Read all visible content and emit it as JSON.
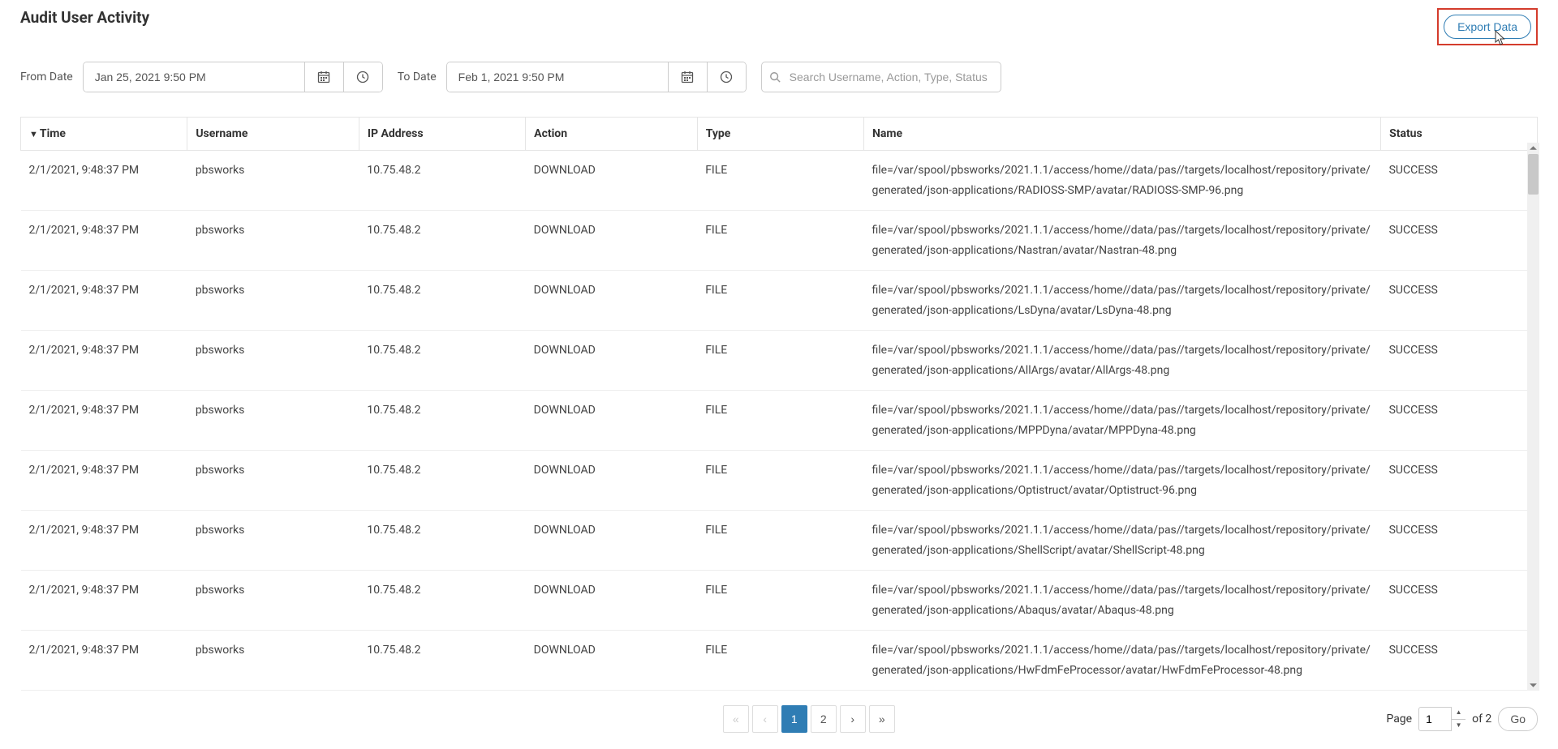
{
  "page_title": "Audit User Activity",
  "export_label": "Export Data",
  "filters": {
    "from_label": "From Date",
    "to_label": "To Date",
    "from_value": "Jan 25, 2021 9:50 PM",
    "to_value": "Feb 1, 2021 9:50 PM",
    "search_placeholder": "Search Username, Action, Type, Status"
  },
  "columns": {
    "time": "Time",
    "username": "Username",
    "ip": "IP Address",
    "action": "Action",
    "type": "Type",
    "name": "Name",
    "status": "Status"
  },
  "sort_indicator": "▼",
  "rows": [
    {
      "time": "2/1/2021, 9:48:37 PM",
      "user": "pbsworks",
      "ip": "10.75.48.2",
      "action": "DOWNLOAD",
      "type": "FILE",
      "name": "file=/var/spool/pbsworks/2021.1.1/access/home//data/pas//targets/localhost/repository/private/generated/json-applications/RADIOSS-SMP/avatar/RADIOSS-SMP-96.png",
      "status": "SUCCESS"
    },
    {
      "time": "2/1/2021, 9:48:37 PM",
      "user": "pbsworks",
      "ip": "10.75.48.2",
      "action": "DOWNLOAD",
      "type": "FILE",
      "name": "file=/var/spool/pbsworks/2021.1.1/access/home//data/pas//targets/localhost/repository/private/generated/json-applications/Nastran/avatar/Nastran-48.png",
      "status": "SUCCESS"
    },
    {
      "time": "2/1/2021, 9:48:37 PM",
      "user": "pbsworks",
      "ip": "10.75.48.2",
      "action": "DOWNLOAD",
      "type": "FILE",
      "name": "file=/var/spool/pbsworks/2021.1.1/access/home//data/pas//targets/localhost/repository/private/generated/json-applications/LsDyna/avatar/LsDyna-48.png",
      "status": "SUCCESS"
    },
    {
      "time": "2/1/2021, 9:48:37 PM",
      "user": "pbsworks",
      "ip": "10.75.48.2",
      "action": "DOWNLOAD",
      "type": "FILE",
      "name": "file=/var/spool/pbsworks/2021.1.1/access/home//data/pas//targets/localhost/repository/private/generated/json-applications/AllArgs/avatar/AllArgs-48.png",
      "status": "SUCCESS"
    },
    {
      "time": "2/1/2021, 9:48:37 PM",
      "user": "pbsworks",
      "ip": "10.75.48.2",
      "action": "DOWNLOAD",
      "type": "FILE",
      "name": "file=/var/spool/pbsworks/2021.1.1/access/home//data/pas//targets/localhost/repository/private/generated/json-applications/MPPDyna/avatar/MPPDyna-48.png",
      "status": "SUCCESS"
    },
    {
      "time": "2/1/2021, 9:48:37 PM",
      "user": "pbsworks",
      "ip": "10.75.48.2",
      "action": "DOWNLOAD",
      "type": "FILE",
      "name": "file=/var/spool/pbsworks/2021.1.1/access/home//data/pas//targets/localhost/repository/private/generated/json-applications/Optistruct/avatar/Optistruct-96.png",
      "status": "SUCCESS"
    },
    {
      "time": "2/1/2021, 9:48:37 PM",
      "user": "pbsworks",
      "ip": "10.75.48.2",
      "action": "DOWNLOAD",
      "type": "FILE",
      "name": "file=/var/spool/pbsworks/2021.1.1/access/home//data/pas//targets/localhost/repository/private/generated/json-applications/ShellScript/avatar/ShellScript-48.png",
      "status": "SUCCESS"
    },
    {
      "time": "2/1/2021, 9:48:37 PM",
      "user": "pbsworks",
      "ip": "10.75.48.2",
      "action": "DOWNLOAD",
      "type": "FILE",
      "name": "file=/var/spool/pbsworks/2021.1.1/access/home//data/pas//targets/localhost/repository/private/generated/json-applications/Abaqus/avatar/Abaqus-48.png",
      "status": "SUCCESS"
    },
    {
      "time": "2/1/2021, 9:48:37 PM",
      "user": "pbsworks",
      "ip": "10.75.48.2",
      "action": "DOWNLOAD",
      "type": "FILE",
      "name": "file=/var/spool/pbsworks/2021.1.1/access/home//data/pas//targets/localhost/repository/private/generated/json-applications/HwFdmFeProcessor/avatar/HwFdmFeProcessor-48.png",
      "status": "SUCCESS"
    }
  ],
  "pagination": {
    "first": "«",
    "prev": "‹",
    "page1": "1",
    "page2": "2",
    "next": "›",
    "last": "»",
    "page_label": "Page",
    "page_value": "1",
    "of_label": "of 2",
    "go_label": "Go"
  }
}
